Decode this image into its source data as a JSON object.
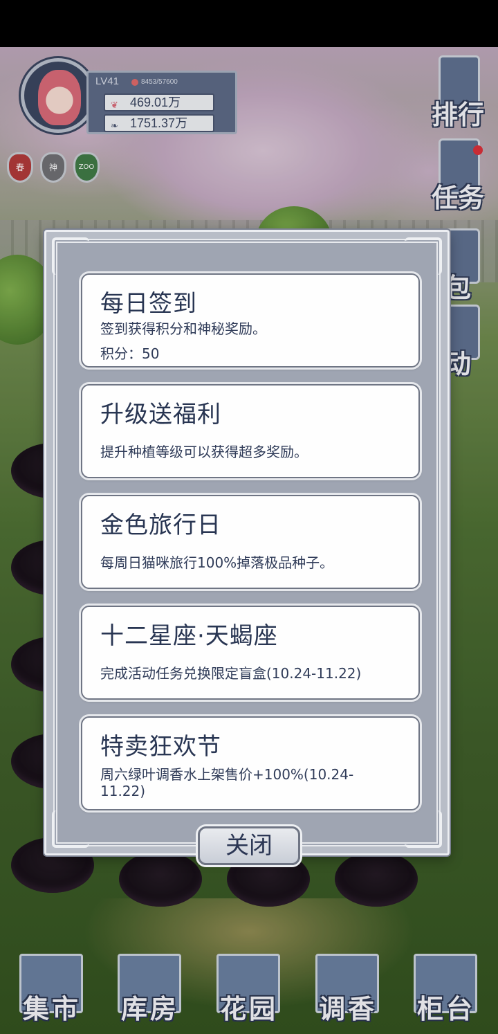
{
  "player": {
    "level": "LV41",
    "exp": "8453/57600",
    "stat1": "469.01万",
    "stat2": "1751.37万",
    "badges": [
      "春",
      "神",
      "ZOO"
    ]
  },
  "side_menu": {
    "ranking": "排行",
    "tasks": "任务",
    "bag": "包",
    "activity": "动"
  },
  "dialog": {
    "cards": [
      {
        "title": "每日签到",
        "desc": "签到获得积分和神秘奖励。",
        "extra": "积分：50"
      },
      {
        "title": "升级送福利",
        "desc": "提升种植等级可以获得超多奖励。"
      },
      {
        "title": "金色旅行日",
        "desc": "每周日猫咪旅行100%掉落极品种子。"
      },
      {
        "title": "十二星座·天蝎座",
        "desc": "完成活动任务兑换限定盲盒(10.24-11.22)"
      },
      {
        "title": "特卖狂欢节",
        "desc": "周六绿叶调香水上架售价+100%(10.24-11.22)"
      }
    ],
    "close_label": "关闭"
  },
  "bottom_nav": [
    "集市",
    "库房",
    "花园",
    "调香",
    "柜台"
  ],
  "colors": {
    "card_bg": "#fefefe",
    "card_text": "#283552",
    "dialog_frame": "#b8bdc7",
    "nav_tile": "#6a7fa0",
    "notification_dot": "#d9303a"
  }
}
